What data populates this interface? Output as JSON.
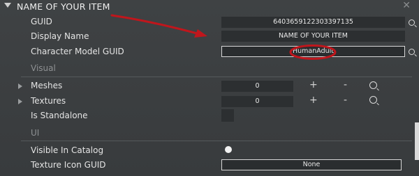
{
  "header": {
    "title": "NAME OF YOUR ITEM",
    "close_glyph": "✕"
  },
  "fields": {
    "guid": {
      "label": "GUID",
      "value": "6403659122303397135"
    },
    "display_name": {
      "label": "Display Name",
      "value": "NAME OF YOUR ITEM"
    },
    "character_model_guid": {
      "label": "Character Model GUID",
      "value": "HumanAdult"
    }
  },
  "sections": {
    "visual": "Visual",
    "ui": "UI"
  },
  "visual": {
    "meshes": {
      "label": "Meshes",
      "count": "0",
      "plus": "+",
      "minus": "-"
    },
    "textures": {
      "label": "Textures",
      "count": "0",
      "plus": "+",
      "minus": "-"
    },
    "is_standalone": {
      "label": "Is Standalone"
    }
  },
  "ui": {
    "visible_in_catalog": {
      "label": "Visible In Catalog"
    },
    "texture_icon_guid": {
      "label": "Texture Icon GUID",
      "value": "None"
    }
  },
  "annotation_colors": {
    "arrow": "#c0161c",
    "ellipse": "#c0161c"
  }
}
